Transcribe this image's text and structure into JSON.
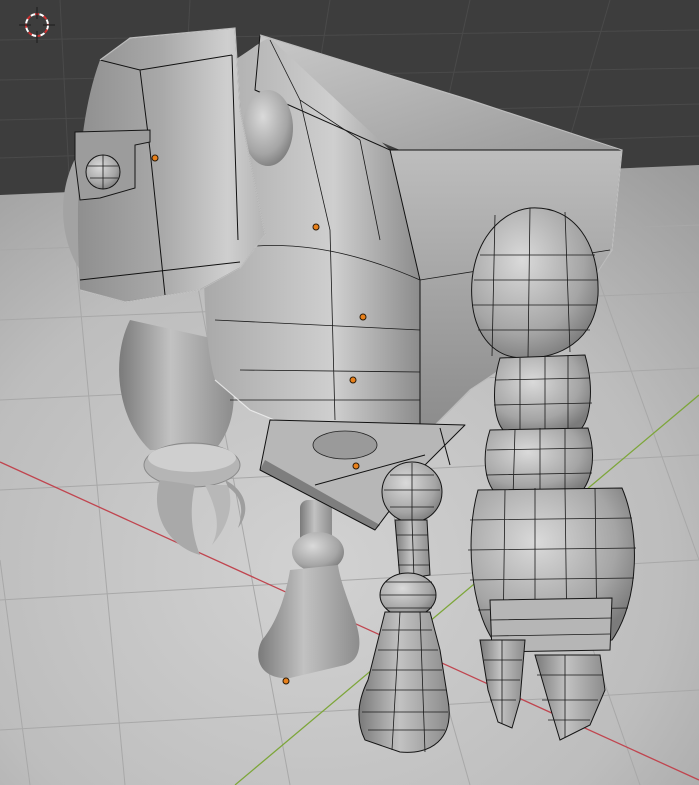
{
  "viewport": {
    "mode": "edit-mode-wireframe-overlay",
    "background_color": "#3d3d3d",
    "grid_color": "#5a5a5a",
    "floor_color": "#c9c9c9",
    "x_axis_color": "#c0454f",
    "y_axis_color": "#7da63a"
  },
  "scene": {
    "cursor_icon": "3d-cursor-icon",
    "object": "robot-mesh",
    "colors": {
      "mesh_light": "#d8d8d8",
      "mesh_mid": "#a7a7a7",
      "mesh_dark": "#6e6e6e",
      "origin_dot": "#e8801a"
    }
  }
}
